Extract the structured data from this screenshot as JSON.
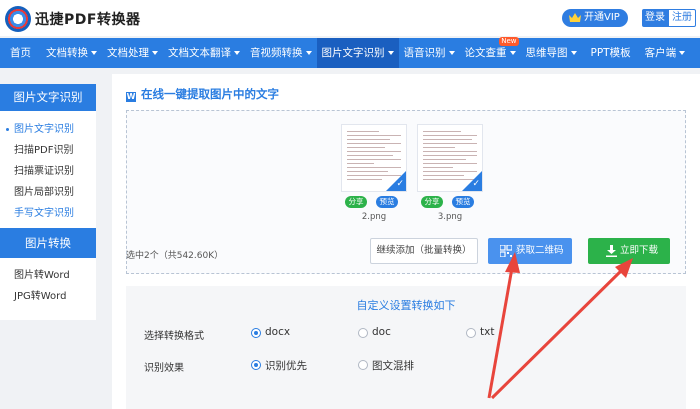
{
  "header": {
    "app_name": "迅捷PDF转换器",
    "vip_label": "开通VIP",
    "login_label": "登录",
    "register_label": "注册"
  },
  "nav": {
    "items": [
      {
        "label": "首页",
        "dropdown": false
      },
      {
        "label": "文档转换",
        "dropdown": true
      },
      {
        "label": "文档处理",
        "dropdown": true
      },
      {
        "label": "文档文本翻译",
        "dropdown": true
      },
      {
        "label": "音视频转换",
        "dropdown": true
      },
      {
        "label": "图片文字识别",
        "dropdown": true,
        "active": true
      },
      {
        "label": "语音识别",
        "dropdown": true
      },
      {
        "label": "论文查重",
        "dropdown": true,
        "badge": "New"
      },
      {
        "label": "思维导图",
        "dropdown": true
      },
      {
        "label": "PPT模板",
        "dropdown": false
      },
      {
        "label": "客户端",
        "dropdown": true
      }
    ]
  },
  "sidebar": {
    "section1_title": "图片文字识别",
    "section1_items": [
      "图片文字识别",
      "扫描PDF识别",
      "扫描票证识别",
      "图片局部识别",
      "手写文字识别"
    ],
    "section2_title": "图片转换",
    "section2_items": [
      "图片转Word",
      "JPG转Word"
    ]
  },
  "main": {
    "title": "在线一键提取图片中的文字",
    "title_icon": "W",
    "files": [
      {
        "name": "2.png",
        "share": "分享",
        "preview": "预览"
      },
      {
        "name": "3.png",
        "share": "分享",
        "preview": "预览"
      }
    ],
    "summary": "选中2个（共542.60K）",
    "add_button": "继续添加（批量转换）",
    "qr_button": "获取二维码",
    "download_button": "立即下载"
  },
  "settings": {
    "title": "自定义设置转换如下",
    "format_label": "选择转换格式",
    "format_options": [
      "docx",
      "doc",
      "txt"
    ],
    "format_selected": "docx",
    "effect_label": "识别效果",
    "effect_options": [
      "识别优先",
      "图文混排"
    ],
    "effect_selected": "识别优先"
  },
  "colors": {
    "brand_blue": "#2a7de1",
    "green": "#2cb24a",
    "arrow_red": "#e8453c"
  }
}
